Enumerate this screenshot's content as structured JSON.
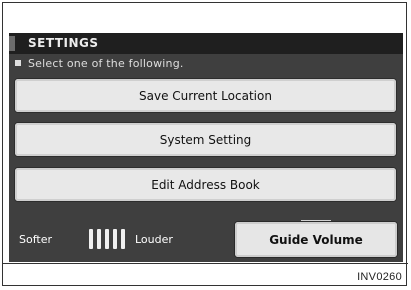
{
  "screen": {
    "title": "SETTINGS",
    "instruction": "Select one of the following.",
    "menu": {
      "save_current_location": "Save Current Location",
      "system_setting": "System Setting",
      "edit_address_book": "Edit Address Book"
    },
    "volume": {
      "softer_label": "Softer",
      "louder_label": "Louder",
      "guide_volume_label": "Guide Volume"
    }
  },
  "caption": "INV0260",
  "colors": {
    "screen_bg": "#3f3f3f",
    "titlebar_bg": "#1f1f1f",
    "button_bg": "#e8e8e8",
    "text_dark": "#111111",
    "text_light": "#ededed"
  }
}
